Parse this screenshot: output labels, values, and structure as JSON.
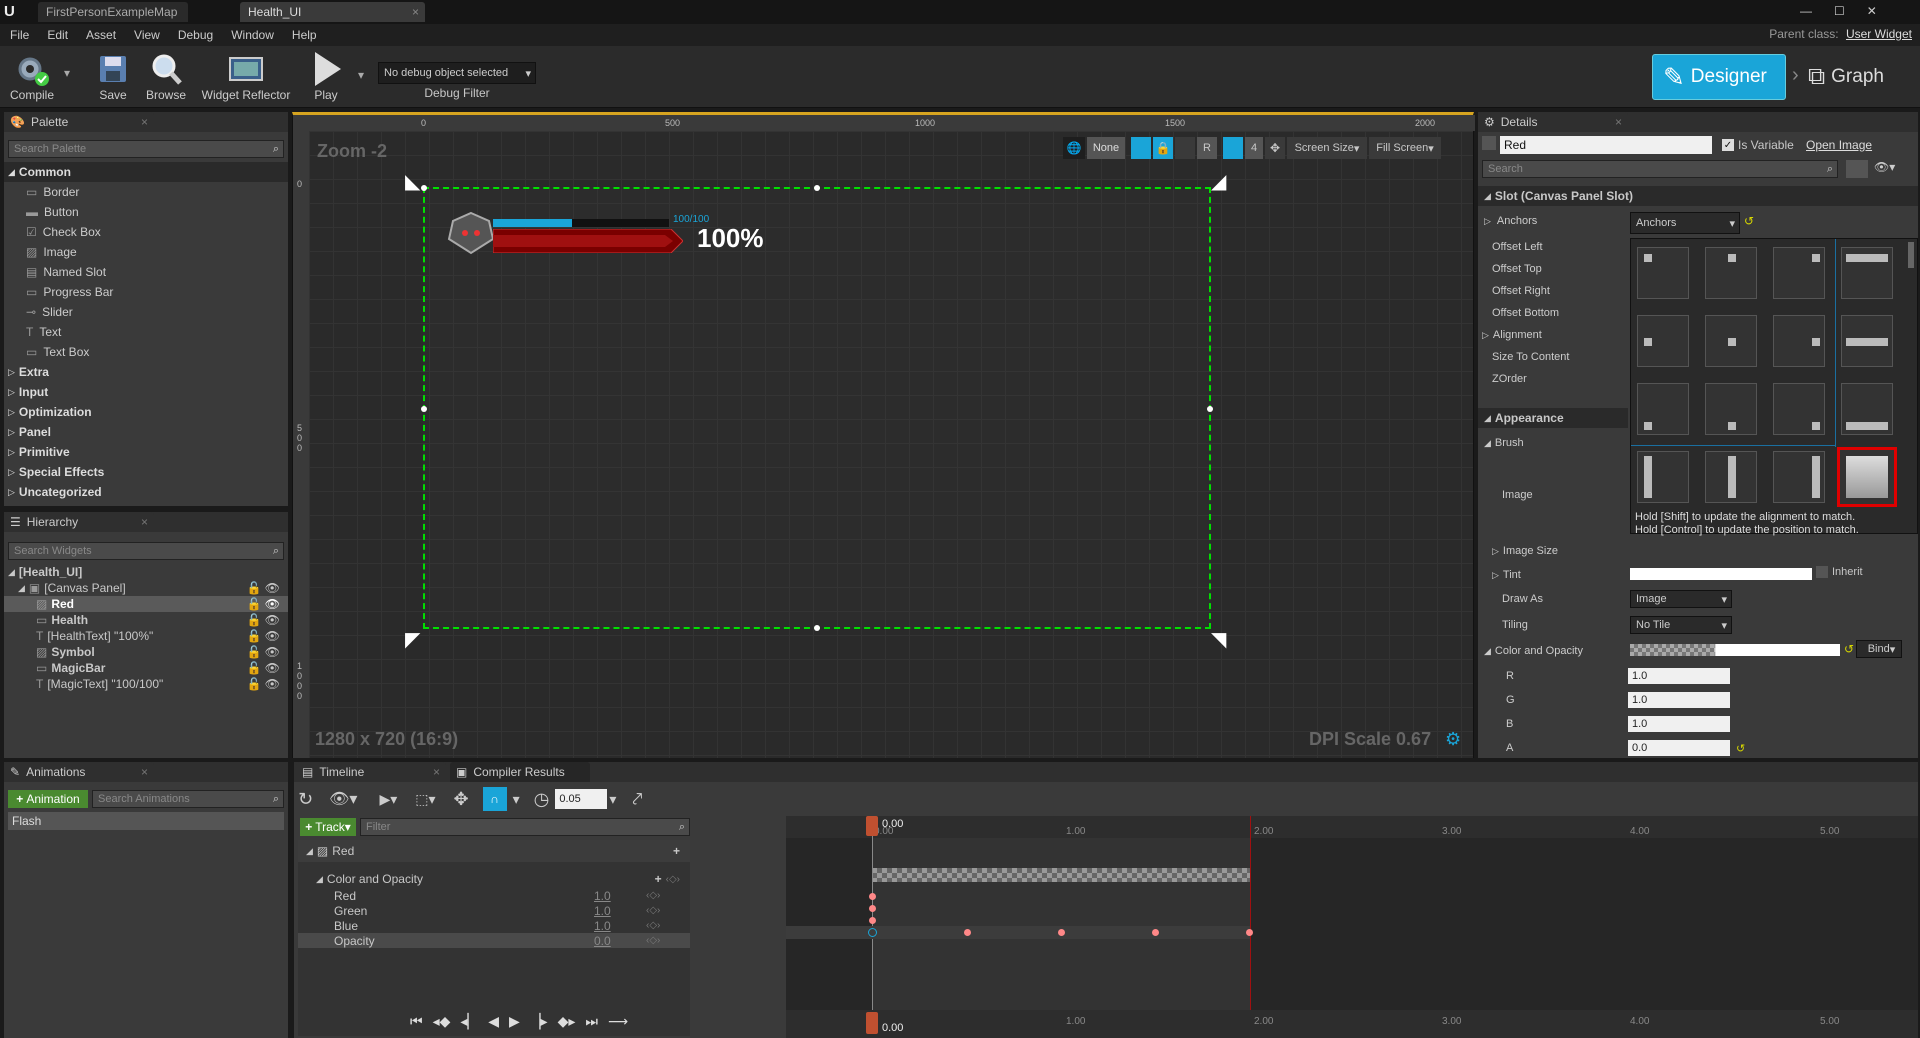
{
  "titlebar": {
    "tabs": [
      {
        "label": "FirstPersonExampleMap"
      },
      {
        "label": "Health_UI"
      }
    ],
    "parent_class_label": "Parent class:",
    "parent_class_value": "User Widget"
  },
  "menu": [
    "File",
    "Edit",
    "Asset",
    "View",
    "Debug",
    "Window",
    "Help"
  ],
  "toolbar": {
    "compile": "Compile",
    "save": "Save",
    "browse": "Browse",
    "reflector": "Widget Reflector",
    "play": "Play",
    "debug_object": "No debug object selected",
    "debug_filter": "Debug Filter",
    "designer": "Designer",
    "graph": "Graph"
  },
  "palette": {
    "tab": "Palette",
    "search_placeholder": "Search Palette",
    "common": "Common",
    "items": [
      "Border",
      "Button",
      "Check Box",
      "Image",
      "Named Slot",
      "Progress Bar",
      "Slider",
      "Text",
      "Text Box"
    ],
    "categories": [
      "Extra",
      "Input",
      "Optimization",
      "Panel",
      "Primitive",
      "Special Effects",
      "Uncategorized"
    ]
  },
  "hierarchy": {
    "tab": "Hierarchy",
    "search_placeholder": "Search Widgets",
    "root": "[Health_UI]",
    "canvas": "[Canvas Panel]",
    "children": [
      "Red",
      "Health",
      "[HealthText] \"100%\"",
      "Symbol",
      "MagicBar",
      "[MagicText] \"100/100\""
    ]
  },
  "animations": {
    "tab": "Animations",
    "add_button": "Animation",
    "search_placeholder": "Search Animations",
    "items": [
      "Flash"
    ]
  },
  "designer": {
    "zoom": "Zoom -2",
    "ruler_top": [
      "0",
      "500",
      "1000",
      "1500",
      "2000"
    ],
    "ruler_left": [
      "0",
      "5\n0\n0",
      "1\n0\n0\n0"
    ],
    "anchor_none": "None",
    "r_label": "R",
    "grid_num": "4",
    "screen_size": "Screen Size",
    "fill_screen": "Fill Screen",
    "resolution": "1280 x 720 (16:9)",
    "dpi": "DPI Scale 0.67",
    "magic_text": "100/100",
    "health_text": "100%",
    "magic_fill": 0.45
  },
  "details": {
    "tab": "Details",
    "name_value": "Red",
    "is_variable": "Is Variable",
    "open_image": "Open Image",
    "search_placeholder": "Search",
    "slot_section": "Slot (Canvas Panel Slot)",
    "anchors_label": "Anchors",
    "anchors_value": "Anchors",
    "slot_props": [
      "Offset Left",
      "Offset Top",
      "Offset Right",
      "Offset Bottom",
      "Alignment",
      "Size To Content",
      "ZOrder"
    ],
    "appearance": "Appearance",
    "brush": "Brush",
    "image": "Image",
    "image_size": "Image Size",
    "tint": "Tint",
    "inherit": "Inherit",
    "draw_as": "Draw As",
    "draw_as_value": "Image",
    "tiling": "Tiling",
    "tiling_value": "No Tile",
    "color_opacity": "Color and Opacity",
    "bind": "Bind",
    "channels": [
      {
        "label": "R",
        "value": "1.0"
      },
      {
        "label": "G",
        "value": "1.0"
      },
      {
        "label": "B",
        "value": "1.0"
      },
      {
        "label": "A",
        "value": "0.0"
      }
    ],
    "hint1": "Hold [Shift] to update the alignment to match.",
    "hint2": "Hold [Control] to update the position to match."
  },
  "timeline": {
    "tab": "Timeline",
    "tab2": "Compiler Results",
    "step": "0.05",
    "track_button": "Track",
    "filter_placeholder": "Filter",
    "object_row": "Red",
    "group": "Color and Opacity",
    "tracks": [
      {
        "name": "Red",
        "value": "1.0"
      },
      {
        "name": "Green",
        "value": "1.0"
      },
      {
        "name": "Blue",
        "value": "1.0"
      },
      {
        "name": "Opacity",
        "value": "0.0"
      }
    ],
    "time_labels": [
      "0.00",
      "1.00",
      "2.00",
      "3.00",
      "4.00",
      "5.00"
    ],
    "current_time": "0.00",
    "cur_time_small": "0.00"
  },
  "colors": {
    "accent": "#1aa5d8",
    "selection": "#00e000",
    "highlight": "#e00000"
  }
}
